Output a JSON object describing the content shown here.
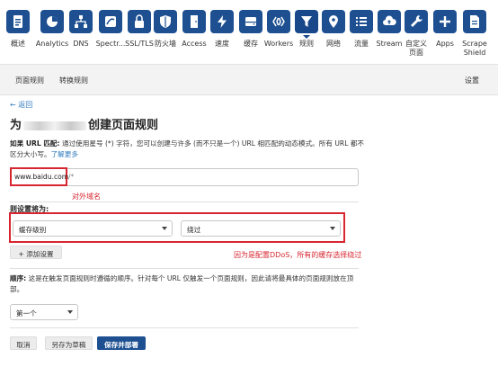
{
  "toolbar": {
    "items": [
      {
        "label": "概述",
        "icon": "overview-doc-icon"
      },
      {
        "label": "Analytics",
        "icon": "pie-chart-icon"
      },
      {
        "label": "DNS",
        "icon": "network-icon"
      },
      {
        "label": "Spectr...",
        "icon": "spectrum-icon"
      },
      {
        "label": "SSL/TLS",
        "icon": "lock-icon"
      },
      {
        "label": "防火墙",
        "icon": "shield-icon"
      },
      {
        "label": "Access",
        "icon": "door-icon"
      },
      {
        "label": "速度",
        "icon": "lightning-icon"
      },
      {
        "label": "缓存",
        "icon": "drive-icon"
      },
      {
        "label": "Workers",
        "icon": "workers-icon"
      },
      {
        "label": "规则",
        "icon": "filter-icon"
      },
      {
        "label": "网络",
        "icon": "location-pin-icon"
      },
      {
        "label": "流量",
        "icon": "list-icon"
      },
      {
        "label": "Stream",
        "icon": "cloud-upload-icon"
      },
      {
        "label": "自定义页面",
        "icon": "wrench-icon"
      },
      {
        "label": "Apps",
        "icon": "plus-icon"
      },
      {
        "label": "Scrape Shield",
        "icon": "document-icon"
      }
    ],
    "active_index": 10
  },
  "subnav": {
    "page_rules": "页面规则",
    "transform_rules": "转换规则",
    "settings": "设置"
  },
  "content": {
    "back": "← 返回",
    "title_prefix": "为",
    "title_suffix": "创建页面规则",
    "desc_bold": "如果 URL 匹配:",
    "desc_text": " 通过使用星号 (*) 字符，您可以创建与许多 (而不只是一个) URL 相匹配的动态模式。所有 URL 都不区分大小写。",
    "desc_link": "了解更多",
    "url_value": "www.baidu.com",
    "url_wildcard": "/*",
    "annotation_domain": "对外域名",
    "settings_label": "则设置将为:",
    "setting_select": "缓存级别",
    "value_select": "绕过",
    "annotation_cache": "因为是配置DDoS，所有的缓存选择绕过",
    "add_setting": "+ 添加设置",
    "order_bold": "顺序:",
    "order_text": " 这是在触发页面规则时遵循的顺序。针对每个 URL 仅触发一个页面规则，因此请将最具体的页面规则放在顶部。",
    "order_select": "第一个"
  },
  "actions": {
    "cancel": "取消",
    "save_draft": "另存为草稿",
    "save_deploy": "保存并部署"
  },
  "colors": {
    "brand": "#1d4f91",
    "annotation": "#d72630",
    "link": "#2f7bbf"
  }
}
